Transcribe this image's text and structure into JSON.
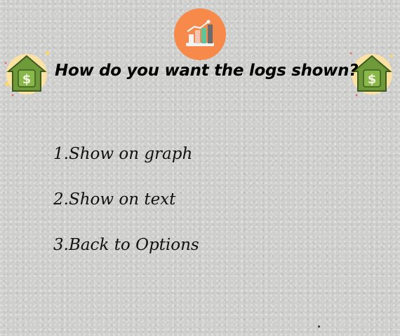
{
  "logo": {
    "icon": "bar-chart-icon",
    "bg_color": "#f7894a"
  },
  "decorations": {
    "left_icon": "house-dollar-icon",
    "right_icon": "house-dollar-icon",
    "house_color": "#6e9a3a",
    "circle_color": "#fbe2a3"
  },
  "title": "How do you want the logs shown?",
  "menu": {
    "items": [
      {
        "label": "1.Show on graph"
      },
      {
        "label": "2.Show on text"
      },
      {
        "label": "3.Back to Options"
      }
    ]
  }
}
